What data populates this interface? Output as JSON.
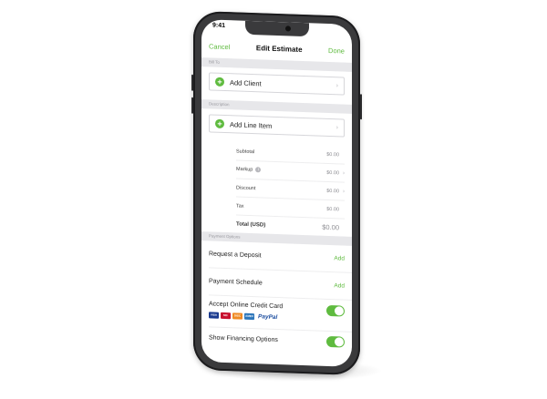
{
  "status": {
    "time": "9:41"
  },
  "nav": {
    "cancel": "Cancel",
    "title": "Edit Estimate",
    "done": "Done"
  },
  "sections": {
    "bill_to": "Bill To",
    "description": "Description",
    "payment": "Payment Options"
  },
  "client": {
    "label": "Add Client"
  },
  "line_item": {
    "label": "Add Line Item"
  },
  "totals": {
    "subtotal": {
      "label": "Subtotal",
      "value": "$0.00"
    },
    "markup": {
      "label": "Markup",
      "value": "$0.00"
    },
    "discount": {
      "label": "Discount",
      "value": "$0.00"
    },
    "tax": {
      "label": "Tax",
      "value": "$0.00"
    },
    "total": {
      "label": "Total (USD)",
      "value": "$0.00"
    }
  },
  "payment": {
    "deposit": {
      "label": "Request a Deposit",
      "action": "Add"
    },
    "schedule": {
      "label": "Payment Schedule",
      "action": "Add"
    },
    "credit_card": {
      "label": "Accept Online Credit Card",
      "enabled": true
    },
    "financing": {
      "label": "Show Financing Options",
      "enabled": true
    }
  },
  "cards": {
    "visa": "VISA",
    "mastercard": "MC",
    "discover": "DISC",
    "amex": "AMEX",
    "paypal": "PayPal"
  },
  "colors": {
    "accent": "#5fbb3f",
    "phone_body": "#3a3a3c",
    "section_bg": "#e7e7ea"
  }
}
